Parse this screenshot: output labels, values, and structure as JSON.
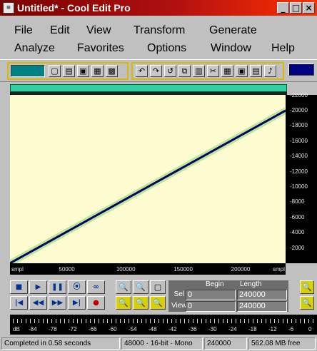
{
  "window": {
    "title": "Untitled* - Cool Edit Pro",
    "icon": "cool-edit-app-icon"
  },
  "window_controls": {
    "minimize": "_",
    "maximize": "□",
    "close": "×"
  },
  "menu": {
    "row1": [
      "File",
      "Edit",
      "View",
      "Transform",
      "Generate"
    ],
    "row2": [
      "Analyze",
      "Favorites",
      "Options",
      "Window",
      "Help"
    ]
  },
  "toolbar": {
    "group1_icons": [
      "new-file-icon",
      "open-file-icon",
      "save-file-icon",
      "save-all-icon",
      "close-file-icon"
    ],
    "group2_icons": [
      "undo-icon",
      "redo-icon",
      "repeat-icon",
      "copy-icon",
      "paste-icon",
      "cut-icon",
      "mix-paste-icon",
      "trim-icon",
      "silence-icon",
      "favorite-icon"
    ]
  },
  "spectral": {
    "frequency_labels": [
      "22000",
      "20000",
      "18000",
      "16000",
      "14000",
      "12000",
      "10000",
      "8000",
      "6000",
      "4000",
      "2000"
    ],
    "time_labels": [
      "smpl",
      "50000",
      "100000",
      "150000",
      "200000",
      "smpl"
    ],
    "sweep_start_hz": 0,
    "sweep_end_hz": 20000,
    "total_samples": 240000,
    "max_freq_hz": 22050
  },
  "selview": {
    "begin_header": "Begin",
    "length_header": "Length",
    "sel_label": "Sel",
    "view_label": "View",
    "sel_begin": "0",
    "sel_length": "240000",
    "view_begin": "0",
    "view_length": "240000"
  },
  "level_meter": {
    "labels": [
      "dB",
      "-84",
      "-78",
      "-72",
      "-66",
      "-60",
      "-54",
      "-48",
      "-42",
      "-36",
      "-30",
      "-24",
      "-18",
      "-12",
      "-6",
      "0"
    ]
  },
  "status": {
    "message": "Completed in 0.58 seconds",
    "format": "48000 · 16-bit · Mono",
    "samples": "240000",
    "free_space": "562.08 MB free"
  },
  "colors": {
    "title_gradient_start": "#7a0000",
    "title_gradient_end": "#ff3000",
    "spectral_background": "#fdfbd0",
    "sweep_line": "#000060",
    "sweep_glow": "#40c040",
    "overview": "#30d0a0"
  }
}
